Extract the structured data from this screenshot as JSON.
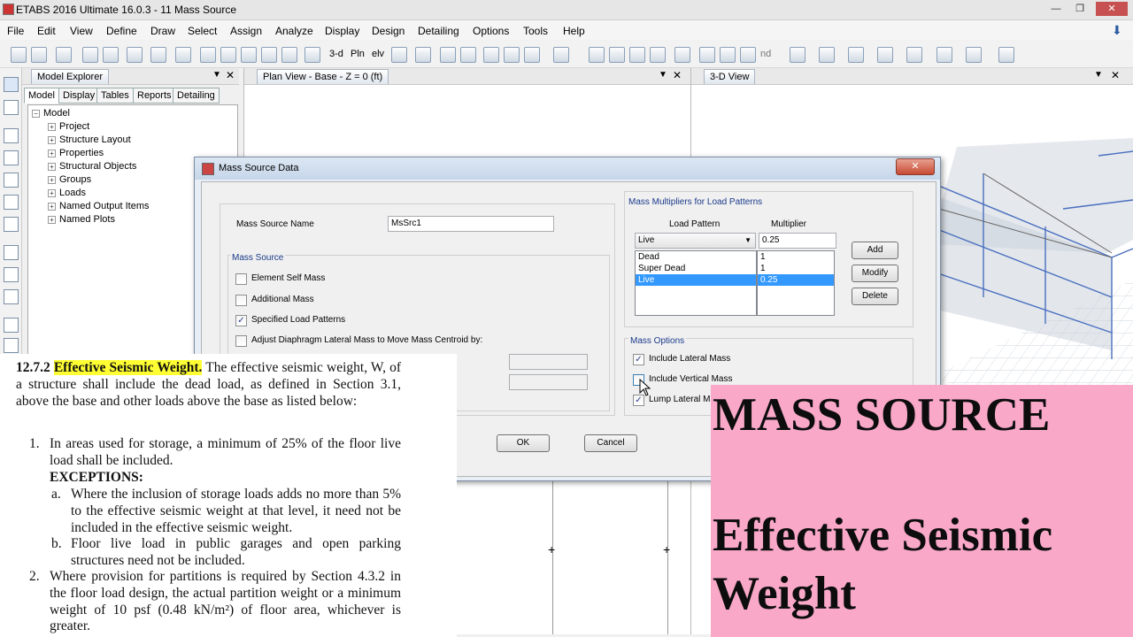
{
  "window": {
    "title": "ETABS 2016 Ultimate 16.0.3 - 11 Mass Source"
  },
  "menubar": {
    "items": [
      "File",
      "Edit",
      "View",
      "Define",
      "Draw",
      "Select",
      "Assign",
      "Analyze",
      "Display",
      "Design",
      "Detailing",
      "Options",
      "Tools",
      "Help"
    ]
  },
  "toolbar": {
    "view_3d": "3-d",
    "plan": "Pln",
    "elev": "elv",
    "nd": "nd"
  },
  "explorer": {
    "title": "Model Explorer",
    "tabs": [
      "Model",
      "Display",
      "Tables",
      "Reports",
      "Detailing"
    ],
    "root": "Model",
    "items": [
      "Project",
      "Structure Layout",
      "Properties",
      "Structural Objects",
      "Groups",
      "Loads",
      "Named Output Items",
      "Named Plots"
    ]
  },
  "plan_view": {
    "title": "Plan View - Base - Z = 0 (ft)"
  },
  "view3d": {
    "title": "3-D View"
  },
  "dialog": {
    "title": "Mass Source Data",
    "name_label": "Mass Source Name",
    "name_value": "MsSrc1",
    "mass_source_group": "Mass Source",
    "options": [
      {
        "label": "Element Self Mass",
        "checked": false
      },
      {
        "label": "Additional Mass",
        "checked": false
      },
      {
        "label": "Specified Load Patterns",
        "checked": true
      },
      {
        "label": "Adjust Diaphragm Lateral Mass to Move Mass Centroid by:",
        "checked": false
      }
    ],
    "multipliers_group": "Mass Multipliers for Load Patterns",
    "col_load_pattern": "Load Pattern",
    "col_multiplier": "Multiplier",
    "selected_pattern": "Live",
    "multiplier_value": "0.25",
    "patterns": [
      "Dead",
      "Super Dead",
      "Live"
    ],
    "multipliers": [
      "1",
      "1",
      "0.25"
    ],
    "add": "Add",
    "modify": "Modify",
    "delete": "Delete",
    "mass_options_group": "Mass Options",
    "mass_options": [
      {
        "label": "Include Lateral Mass",
        "checked": true
      },
      {
        "label": "Include Vertical Mass",
        "checked": false
      },
      {
        "label": "Lump Lateral Mass",
        "checked": true
      }
    ],
    "ok": "OK",
    "cancel": "Cancel"
  },
  "doc_overlay": {
    "section": "12.7.2",
    "heading": "Effective Seismic Weight.",
    "para1": "The effective seismic weight, W, of a structure shall include the dead load, as defined in Section 3.1, above the base and other loads above the base as listed below:",
    "item1_num": "1.",
    "item1": "In areas used for storage, a minimum of 25% of the floor live load shall be included.",
    "exceptions": "EXCEPTIONS:",
    "exc_a_num": "a.",
    "exc_a": "Where the inclusion of storage loads adds no more than 5% to the effective seismic weight at that level, it need not be included in the effective seismic weight.",
    "exc_b_num": "b.",
    "exc_b": "Floor live load in public garages and open parking structures need not be included.",
    "item2_num": "2.",
    "item2": "Where provision for partitions is required by Section 4.3.2 in the floor load design, the actual partition weight or a minimum weight of 10 psf (0.48 kN/m²) of floor area, whichever is greater."
  },
  "banner": {
    "line1": "MASS SOURCE",
    "line2": "Effective Seismic",
    "line3": "Weight"
  }
}
